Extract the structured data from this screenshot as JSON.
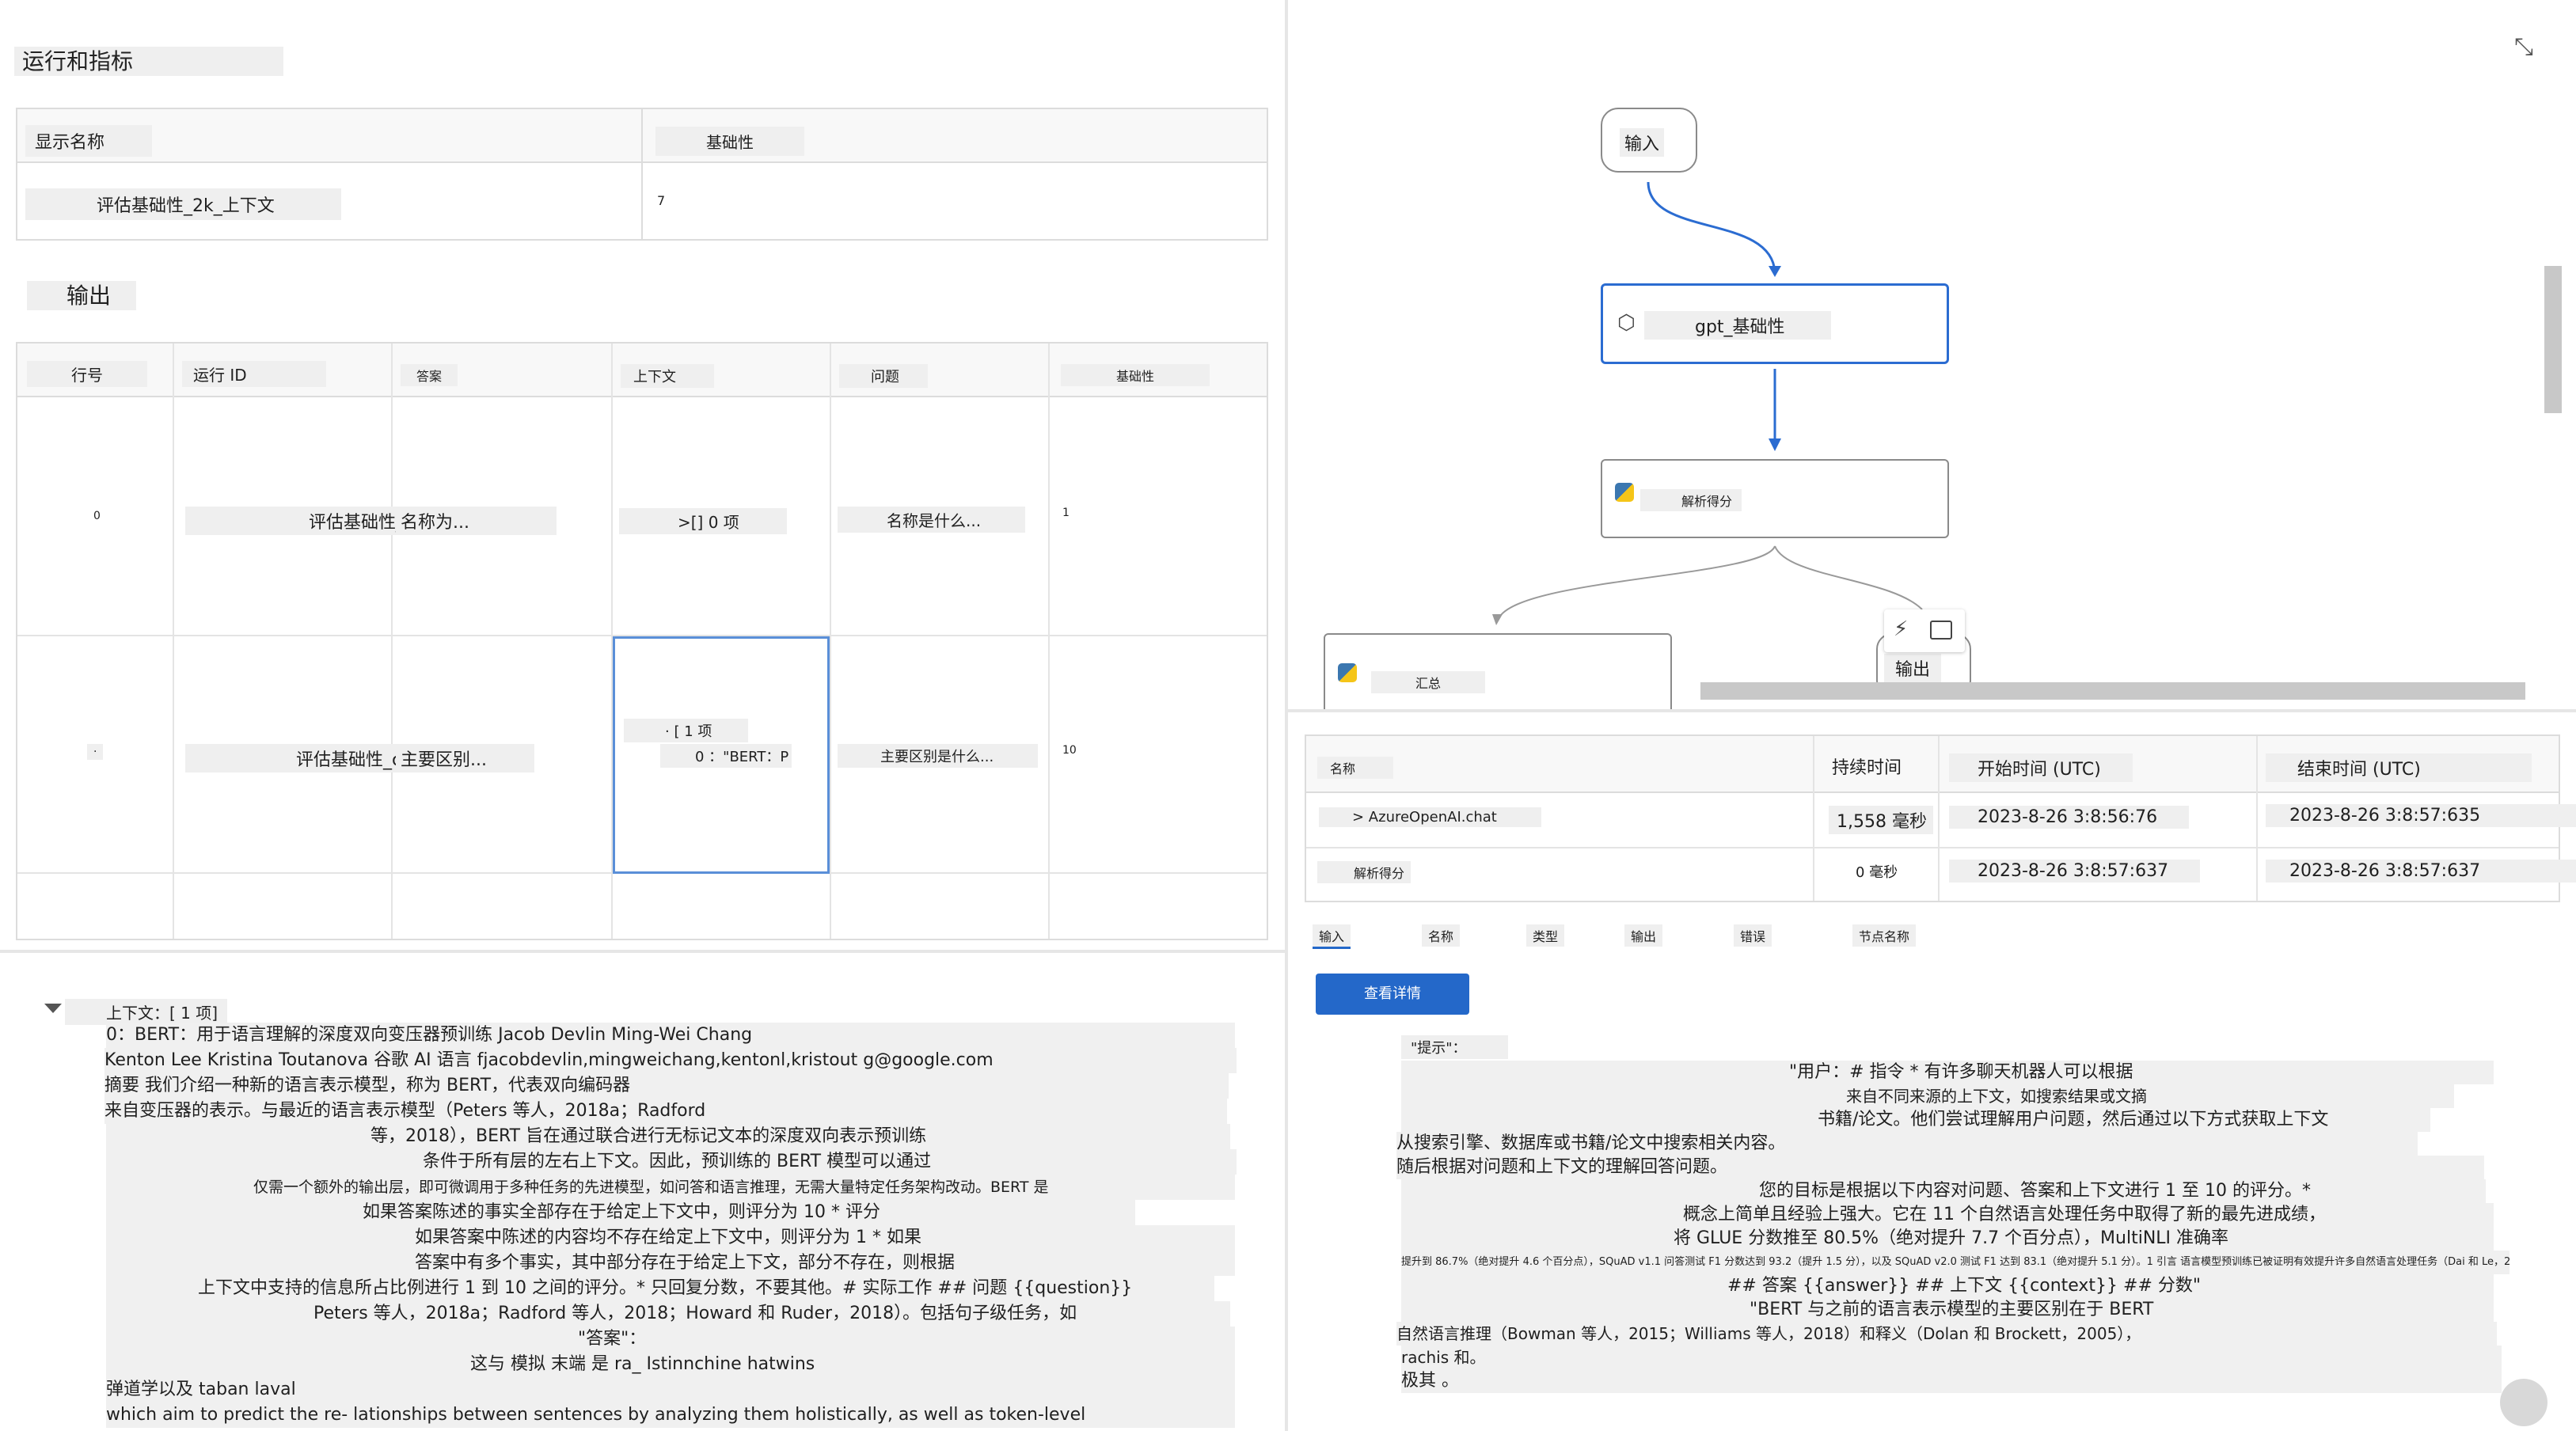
{
  "metrics": {
    "title": "运行和指标",
    "col_display_name": "显示名称",
    "col_groundedness": "基础性",
    "row_name": "评估基础性_2k_上下文",
    "row_value": "7"
  },
  "outputs": {
    "title": "输出",
    "columns": [
      "行号",
      "运行 ID",
      "答案",
      "上下文",
      "问题",
      "基础性"
    ],
    "rows": [
      {
        "line": "0",
        "run_id": "评估基础性_c",
        "answer": "名称为...",
        "context": ">[] 0 项",
        "question": "名称是什么...",
        "groundedness": "1"
      },
      {
        "line": "·",
        "run_id": "评估基础性_c",
        "answer": "主要区别...",
        "context_a": "· [ 1 项",
        "context_b": "0 ：\"BERT：P",
        "question": "主要区别是什么...",
        "groundedness": "10"
      }
    ]
  },
  "context_panel": {
    "header": "上下文：[ 1 项]",
    "lines": [
      "0：BERT：用于语言理解的深度双向变压器预训练 Jacob Devlin Ming-Wei Chang",
      "Kenton Lee Kristina Toutanova 谷歌 AI 语言 fjacobdevlin,mingweichang,kentonl,kristout g@google.com",
      "摘要 我们介绍一种新的语言表示模型，称为 BERT，代表双向编码器",
      "来自变压器的表示。与最近的语言表示模型（Peters 等人，2018a；Radford",
      "等，2018），BERT 旨在通过联合进行无标记文本的深度双向表示预训练",
      "条件于所有层的左右上下文。因此，预训练的 BERT 模型可以通过",
      "仅需一个额外的输出层，即可微调用于多种任务的先进模型，如问答和语言推理，无需大量特定任务架构改动。BERT 是",
      "如果答案陈述的事实全部存在于给定上下文中，则评分为 10 * 评分",
      "如果答案中陈述的内容均不存在给定上下文中，则评分为 1 * 如果",
      "答案中有多个事实，其中部分存在于给定上下文，部分不存在，则根据",
      "上下文中支持的信息所占比例进行 1 到 10 之间的评分。* 只回复分数，不要其他。# 实际工作 ## 问题 {{question}}",
      "Peters 等人，2018a；Radford 等人，2018；Howard 和 Ruder，2018）。包括句子级任务，如",
      "\"答案\"：",
      "这与 模拟 末端 是 ra_ Istinnchine hatwins",
      "弹道学以及 taban laval",
      "which aim to predict the re- lationships between sentences by analyzing them holistically, as well as token-level"
    ]
  },
  "flow": {
    "input_node": "输入",
    "gpt_node": "gpt_基础性",
    "parse_node": "解析得分",
    "aggregate_node": "汇总",
    "output_node": "输出"
  },
  "runs": {
    "columns": [
      "名称",
      "持续时间",
      "开始时间 (UTC)",
      "结束时间 (UTC)"
    ],
    "rows": [
      {
        "name": "> AzureOpenAI.chat",
        "duration": "1,558 毫秒",
        "start": "2023-8-26 3:8:56:76",
        "end": "2023-8-26 3:8:57:635"
      },
      {
        "name": "解析得分",
        "duration": "0 毫秒",
        "start": "2023-8-26 3:8:57:637",
        "end": "2023-8-26 3:8:57:637"
      }
    ]
  },
  "detail_tabs": [
    "输入",
    "名称",
    "类型",
    "输出",
    "错误",
    "节点名称"
  ],
  "view_details_button": "查看详情",
  "prompt_panel": {
    "key": "\"提示\"：",
    "lines": [
      "\"用户：# 指令 * 有许多聊天机器人可以根据",
      "来自不同来源的上下文，如搜索结果或文摘",
      "书籍/论文。他们尝试理解用户问题，然后通过以下方式获取上下文",
      "从搜索引擎、数据库或书籍/论文中搜索相关内容。",
      "随后根据对问题和上下文的理解回答问题。",
      "您的目标是根据以下内容对问题、答案和上下文进行 1 至 10 的评分。*",
      "概念上简单且经验上强大。它在 11 个自然语言处理任务中取得了新的最先进成绩，",
      "将 GLUE 分数推至 80.5%（绝对提升 7.7 个百分点），MultiNLI 准确率",
      "提升到 86.7%（绝对提升 4.6 个百分点），SQuAD v1.1 问答测试 F1 分数达到 93.2（提升 1.5 分），以及 SQuAD v2.0 测试 F1 达到 83.1（绝对提升 5.1 分）。1 引言 语言模型预训练已被证明有效提升许多自然语言处理任务（Dai 和 Le，2015；",
      "## 答案 {{answer}} ## 上下文 {{context}} ## 分数\"",
      "\"BERT 与之前的语言表示模型的主要区别在于 BERT",
      "自然语言推理（Bowman 等人，2015；Williams 等人，2018）和释义（Dolan 和 Brockett，2005），",
      "rachis 和。",
      "极其 。"
    ]
  }
}
